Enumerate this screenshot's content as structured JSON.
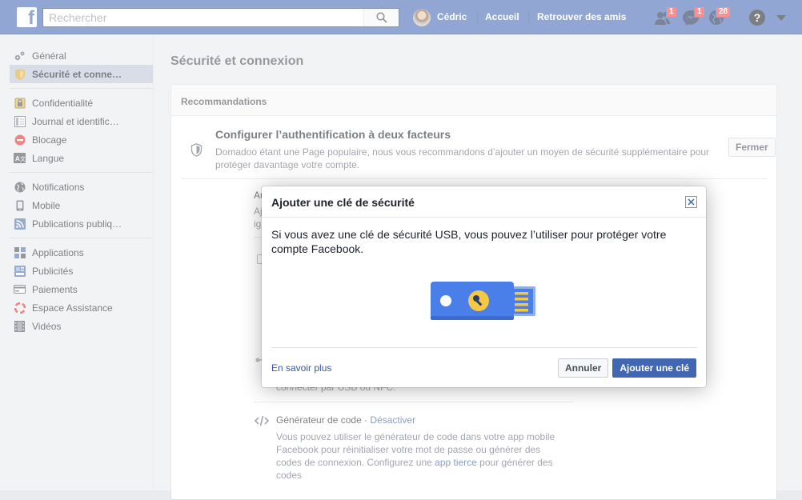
{
  "topbar": {
    "search_placeholder": "Rechercher",
    "user_name": "Cédric",
    "home_label": "Accueil",
    "find_friends_label": "Retrouver des amis",
    "friend_requests_count": "1",
    "messages_count": "1",
    "notifications_count": "28",
    "help_label": "?"
  },
  "sidebar": {
    "groups": [
      [
        {
          "label": "Général",
          "icon": "gears-icon"
        },
        {
          "label": "Sécurité et conne…",
          "icon": "shield-badge-icon",
          "active": true
        }
      ],
      [
        {
          "label": "Confidentialité",
          "icon": "lock-icon"
        },
        {
          "label": "Journal et identific…",
          "icon": "timeline-icon"
        },
        {
          "label": "Blocage",
          "icon": "block-icon"
        },
        {
          "label": "Langue",
          "icon": "language-icon"
        }
      ],
      [
        {
          "label": "Notifications",
          "icon": "globe-icon"
        },
        {
          "label": "Mobile",
          "icon": "mobile-icon"
        },
        {
          "label": "Publications publiq…",
          "icon": "rss-icon"
        }
      ],
      [
        {
          "label": "Applications",
          "icon": "apps-icon"
        },
        {
          "label": "Publicités",
          "icon": "ads-icon"
        },
        {
          "label": "Paiements",
          "icon": "payment-card-icon"
        },
        {
          "label": "Espace Assistance",
          "icon": "lifebuoy-icon"
        },
        {
          "label": "Vidéos",
          "icon": "film-icon"
        }
      ]
    ]
  },
  "main": {
    "title": "Sécurité et connexion",
    "panel_header": "Recommandations",
    "recommendation": {
      "title": "Configurer l’authentification à deux facteurs",
      "description": "Domadoo étant une Page populaire, nous vous recommandons d’ajouter un moyen de sécurité supplémentaire pour protéger davantage votre compte.",
      "close_label": "Fermer"
    },
    "bg_fragments": {
      "a1": "Au",
      "a2": "Aj",
      "a3": "ig",
      "usb_tail": "connecter par USB ou NFC."
    },
    "code_generator": {
      "title": "Générateur de code · ",
      "action": "Désactiver",
      "desc1": "Vous pouvez utiliser le générateur de code dans votre app mobile",
      "desc2": "Facebook pour réinitialiser votre mot de passe ou générer des",
      "desc3_pre": "codes de connexion. Configurez une ",
      "desc3_link": "app tierce",
      "desc3_post": " pour générer des",
      "desc4": "codes"
    }
  },
  "modal": {
    "title": "Ajouter une clé de sécurité",
    "body": "Si vous avez une clé de sécurité USB, vous pouvez l’utiliser pour protéger votre compte Facebook.",
    "learn_more": "En savoir plus",
    "cancel_label": "Annuler",
    "add_key_label": "Ajouter une clé"
  },
  "colors": {
    "brand": "#4267b2",
    "usb_key_body": "#4a7ee8",
    "usb_key_accent": "#f5c843"
  }
}
